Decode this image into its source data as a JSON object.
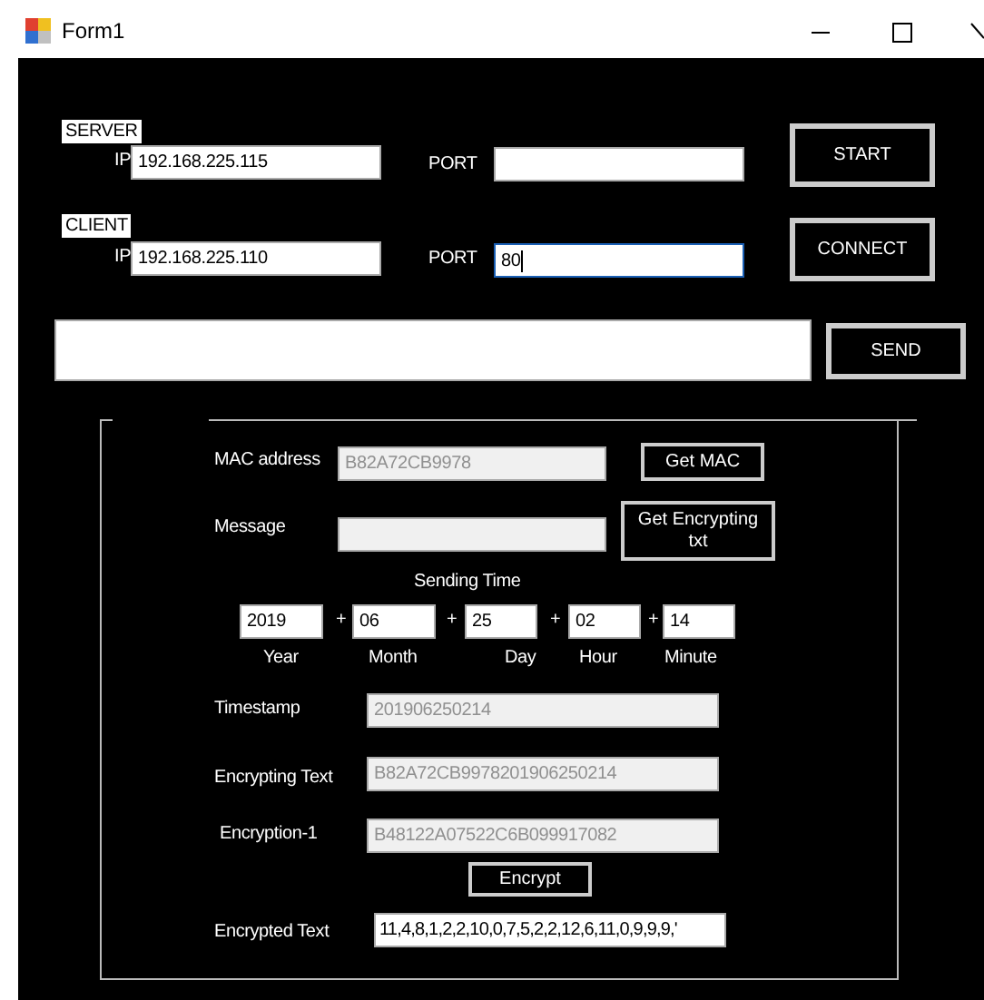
{
  "window": {
    "title": "Form1"
  },
  "endpoints": [
    {
      "heading": "SERVER",
      "ip_label": "IP",
      "ip": "192.168.225.115",
      "port_label": "PORT",
      "port_focused": false,
      "button": "START"
    },
    {
      "heading": "CLIENT",
      "ip_label": "IP",
      "ip": "192.168.225.110",
      "port_label": "PORT",
      "port": "80",
      "port_focused": true,
      "button": "CONNECT"
    }
  ],
  "send_button": "SEND",
  "mac": {
    "label": "MAC address",
    "value": "B82A72CB9978",
    "readonly": true,
    "button": "Get MAC"
  },
  "message": {
    "label": "Message",
    "readonly": true,
    "button_lines": [
      "Get Encrypting",
      "txt"
    ]
  },
  "sending_time": {
    "title": "Sending Time",
    "separator": "+",
    "parts": [
      {
        "label": "Year",
        "value": "2019"
      },
      {
        "label": "Month",
        "value": "06"
      },
      {
        "label": "Day",
        "value": "25"
      },
      {
        "label": "Hour",
        "value": "02"
      },
      {
        "label": "Minute",
        "value": "14"
      }
    ]
  },
  "outputs": [
    {
      "label": "Timestamp",
      "value": "201906250214",
      "readonly": true
    },
    {
      "label": "Encrypting Text",
      "value": "B82A72CB9978201906250214",
      "readonly": true
    },
    {
      "label": "Encryption-1",
      "value": "B48122A07522C6B099917082",
      "readonly": true
    }
  ],
  "encrypt_button": "Encrypt",
  "encrypted": {
    "label": "Encrypted Text",
    "value": "11,4,8,1,2,2,10,0,7,5,2,2,12,6,11,0,9,9,9,'",
    "readonly": false
  }
}
